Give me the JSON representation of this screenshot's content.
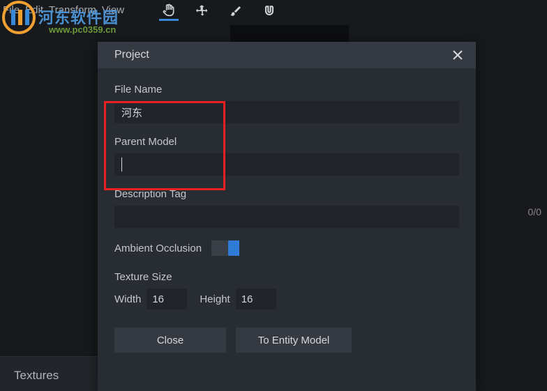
{
  "menu": {
    "file": "File",
    "edit": "Edit",
    "transform": "Transform",
    "view": "View"
  },
  "watermark": {
    "text": "河东软件园",
    "url": "www.pc0359.cn"
  },
  "counter": "0/0",
  "textures_tab": "Textures",
  "dialog": {
    "title": "Project",
    "file_name_label": "File Name",
    "file_name_value": "河东",
    "parent_model_label": "Parent Model",
    "parent_model_value": "",
    "description_tag_label": "Description Tag",
    "description_tag_value": "",
    "ambient_occlusion_label": "Ambient Occlusion",
    "texture_size_label": "Texture Size",
    "width_label": "Width",
    "width_value": "16",
    "height_label": "Height",
    "height_value": "16",
    "close_button": "Close",
    "entity_button": "To Entity Model"
  }
}
